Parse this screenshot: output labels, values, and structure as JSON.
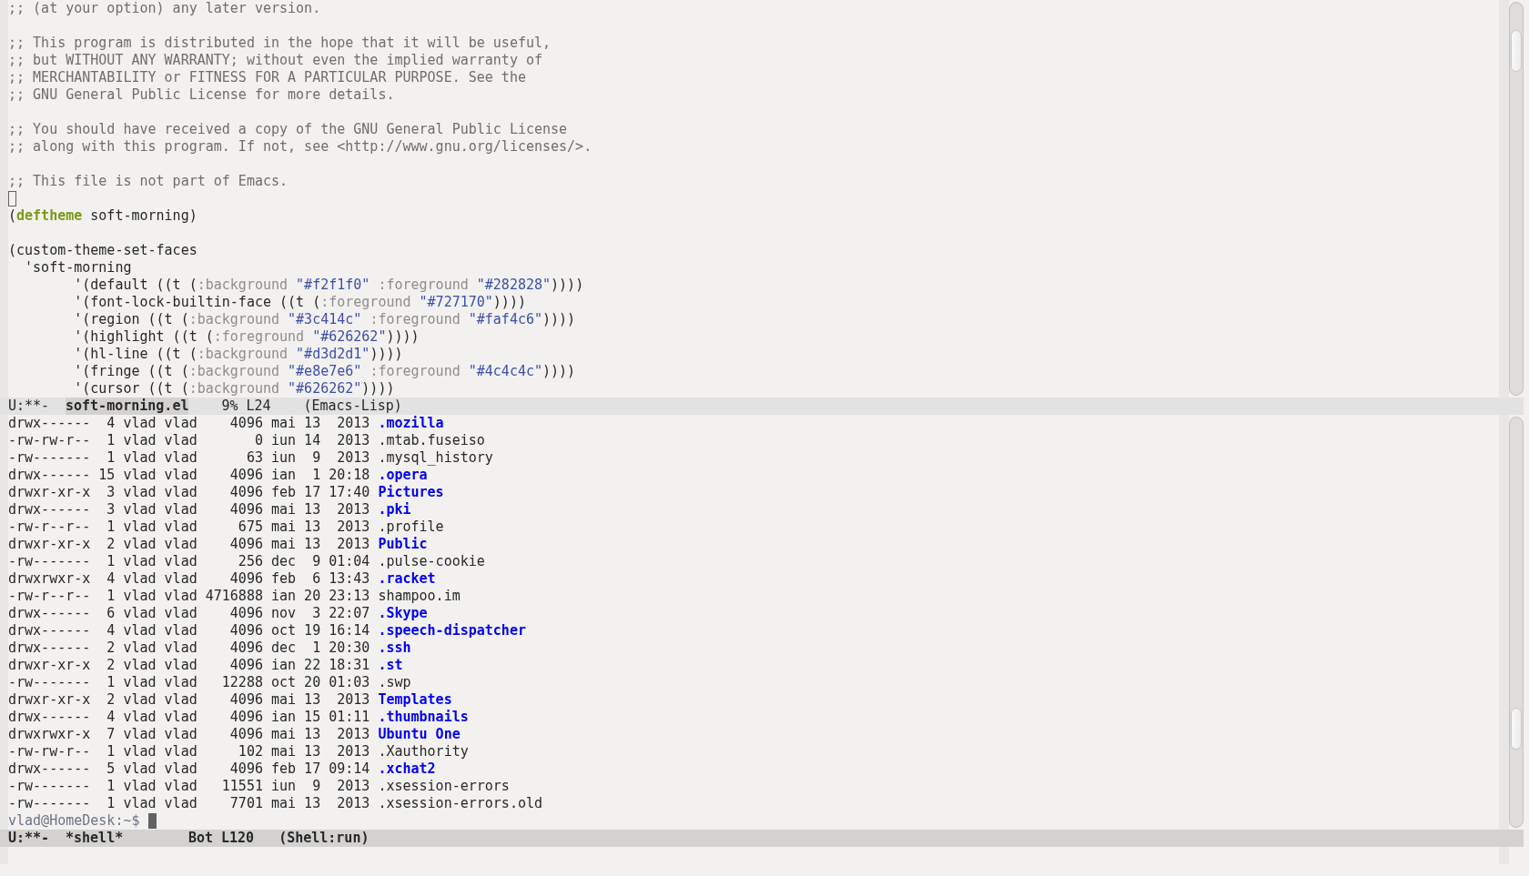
{
  "editor_pane": {
    "paragraphs": [
      {
        "lines": [
          {
            "segments": [
              {
                "kind": "comment",
                "text": ";; (at your option) any later version."
              }
            ]
          }
        ]
      },
      {
        "lines": [
          {
            "segments": [
              {
                "kind": "comment",
                "text": ";; This program is distributed in the hope that it will be useful,"
              }
            ]
          },
          {
            "segments": [
              {
                "kind": "comment",
                "text": ";; but WITHOUT ANY WARRANTY; without even the implied warranty of"
              }
            ]
          },
          {
            "segments": [
              {
                "kind": "comment",
                "text": ";; MERCHANTABILITY or FITNESS FOR A PARTICULAR PURPOSE. See the"
              }
            ]
          },
          {
            "segments": [
              {
                "kind": "comment",
                "text": ";; GNU General Public License for more details."
              }
            ]
          }
        ]
      },
      {
        "lines": [
          {
            "segments": [
              {
                "kind": "comment",
                "text": ";; You should have received a copy of the GNU General Public License"
              }
            ]
          },
          {
            "segments": [
              {
                "kind": "comment",
                "text": ";; along with this program. If not, see <http://www.gnu.org/licenses/>."
              }
            ]
          }
        ]
      },
      {
        "lines": [
          {
            "segments": [
              {
                "kind": "comment",
                "text": ";; This file is not part of Emacs."
              }
            ]
          },
          {
            "cursor": true
          },
          {
            "segments": [
              {
                "kind": "text",
                "text": "("
              },
              {
                "kind": "keyword",
                "text": "deftheme"
              },
              {
                "kind": "text",
                "text": " soft-morning)"
              }
            ]
          }
        ]
      },
      {
        "lines": [
          {
            "segments": [
              {
                "kind": "text",
                "text": "(custom-theme-set-faces"
              }
            ]
          },
          {
            "segments": [
              {
                "kind": "text",
                "text": "  'soft-morning"
              }
            ]
          },
          {
            "segments": [
              {
                "kind": "text",
                "text": "        '(default ((t ("
              },
              {
                "kind": "builtin",
                "text": ":background "
              },
              {
                "kind": "string",
                "text": "\"#f2f1f0\" "
              },
              {
                "kind": "builtin",
                "text": ":foreground "
              },
              {
                "kind": "string",
                "text": "\"#282828\""
              },
              {
                "kind": "text",
                "text": "))))"
              }
            ]
          },
          {
            "segments": [
              {
                "kind": "text",
                "text": "        '(font-lock-builtin-face ((t ("
              },
              {
                "kind": "builtin",
                "text": ":foreground "
              },
              {
                "kind": "string",
                "text": "\"#727170\""
              },
              {
                "kind": "text",
                "text": "))))"
              }
            ]
          },
          {
            "segments": [
              {
                "kind": "text",
                "text": "        '(region ((t ("
              },
              {
                "kind": "builtin",
                "text": ":background "
              },
              {
                "kind": "string",
                "text": "\"#3c414c\" "
              },
              {
                "kind": "builtin",
                "text": ":foreground "
              },
              {
                "kind": "string",
                "text": "\"#faf4c6\""
              },
              {
                "kind": "text",
                "text": "))))"
              }
            ]
          },
          {
            "segments": [
              {
                "kind": "text",
                "text": "        '(highlight ((t ("
              },
              {
                "kind": "builtin",
                "text": ":foreground "
              },
              {
                "kind": "string",
                "text": "\"#626262\""
              },
              {
                "kind": "text",
                "text": "))))"
              }
            ]
          },
          {
            "segments": [
              {
                "kind": "text",
                "text": "        '(hl-line ((t ("
              },
              {
                "kind": "builtin",
                "text": ":background "
              },
              {
                "kind": "string",
                "text": "\"#d3d2d1\""
              },
              {
                "kind": "text",
                "text": "))))"
              }
            ]
          },
          {
            "segments": [
              {
                "kind": "text",
                "text": "        '(fringe ((t ("
              },
              {
                "kind": "builtin",
                "text": ":background "
              },
              {
                "kind": "string",
                "text": "\"#e8e7e6\" "
              },
              {
                "kind": "builtin",
                "text": ":foreground "
              },
              {
                "kind": "string",
                "text": "\"#4c4c4c\""
              },
              {
                "kind": "text",
                "text": "))))"
              }
            ]
          },
          {
            "segments": [
              {
                "kind": "text",
                "text": "        '(cursor ((t ("
              },
              {
                "kind": "builtin",
                "text": ":background "
              },
              {
                "kind": "string",
                "text": "\"#626262\""
              },
              {
                "kind": "text",
                "text": "))))"
              }
            ]
          }
        ]
      }
    ],
    "mode_line": {
      "status": "U:**-",
      "buffer": "soft-morning.el",
      "percent": "9%",
      "line": "L24",
      "mode": "(Emacs-Lisp)",
      "active": false
    }
  },
  "shell_pane": {
    "entries": [
      {
        "perms": "drwx------",
        "links": "4",
        "owner": "vlad",
        "group": "vlad",
        "size": "4096",
        "month": "mai",
        "day": "13",
        "time": "2013",
        "name": ".mozilla",
        "kind": "directory"
      },
      {
        "perms": "-rw-rw-r--",
        "links": "1",
        "owner": "vlad",
        "group": "vlad",
        "size": "0",
        "month": "iun",
        "day": "14",
        "time": "2013",
        "name": ".mtab.fuseiso",
        "kind": "file"
      },
      {
        "perms": "-rw-------",
        "links": "1",
        "owner": "vlad",
        "group": "vlad",
        "size": "63",
        "month": "iun",
        "day": "9",
        "time": "2013",
        "name": ".mysql_history",
        "kind": "file"
      },
      {
        "perms": "drwx------",
        "links": "15",
        "owner": "vlad",
        "group": "vlad",
        "size": "4096",
        "month": "ian",
        "day": "1",
        "time": "20:18",
        "name": ".opera",
        "kind": "directory"
      },
      {
        "perms": "drwxr-xr-x",
        "links": "3",
        "owner": "vlad",
        "group": "vlad",
        "size": "4096",
        "month": "feb",
        "day": "17",
        "time": "17:40",
        "name": "Pictures",
        "kind": "directory"
      },
      {
        "perms": "drwx------",
        "links": "3",
        "owner": "vlad",
        "group": "vlad",
        "size": "4096",
        "month": "mai",
        "day": "13",
        "time": "2013",
        "name": ".pki",
        "kind": "directory"
      },
      {
        "perms": "-rw-r--r--",
        "links": "1",
        "owner": "vlad",
        "group": "vlad",
        "size": "675",
        "month": "mai",
        "day": "13",
        "time": "2013",
        "name": ".profile",
        "kind": "file"
      },
      {
        "perms": "drwxr-xr-x",
        "links": "2",
        "owner": "vlad",
        "group": "vlad",
        "size": "4096",
        "month": "mai",
        "day": "13",
        "time": "2013",
        "name": "Public",
        "kind": "directory"
      },
      {
        "perms": "-rw-------",
        "links": "1",
        "owner": "vlad",
        "group": "vlad",
        "size": "256",
        "month": "dec",
        "day": "9",
        "time": "01:04",
        "name": ".pulse-cookie",
        "kind": "file"
      },
      {
        "perms": "drwxrwxr-x",
        "links": "4",
        "owner": "vlad",
        "group": "vlad",
        "size": "4096",
        "month": "feb",
        "day": "6",
        "time": "13:43",
        "name": ".racket",
        "kind": "directory"
      },
      {
        "perms": "-rw-r--r--",
        "links": "1",
        "owner": "vlad",
        "group": "vlad",
        "size": "4716888",
        "month": "ian",
        "day": "20",
        "time": "23:13",
        "name": "shampoo.im",
        "kind": "file"
      },
      {
        "perms": "drwx------",
        "links": "6",
        "owner": "vlad",
        "group": "vlad",
        "size": "4096",
        "month": "nov",
        "day": "3",
        "time": "22:07",
        "name": ".Skype",
        "kind": "directory"
      },
      {
        "perms": "drwx------",
        "links": "4",
        "owner": "vlad",
        "group": "vlad",
        "size": "4096",
        "month": "oct",
        "day": "19",
        "time": "16:14",
        "name": ".speech-dispatcher",
        "kind": "directory"
      },
      {
        "perms": "drwx------",
        "links": "2",
        "owner": "vlad",
        "group": "vlad",
        "size": "4096",
        "month": "dec",
        "day": "1",
        "time": "20:30",
        "name": ".ssh",
        "kind": "directory"
      },
      {
        "perms": "drwxr-xr-x",
        "links": "2",
        "owner": "vlad",
        "group": "vlad",
        "size": "4096",
        "month": "ian",
        "day": "22",
        "time": "18:31",
        "name": ".st",
        "kind": "directory"
      },
      {
        "perms": "-rw-------",
        "links": "1",
        "owner": "vlad",
        "group": "vlad",
        "size": "12288",
        "month": "oct",
        "day": "20",
        "time": "01:03",
        "name": ".swp",
        "kind": "file"
      },
      {
        "perms": "drwxr-xr-x",
        "links": "2",
        "owner": "vlad",
        "group": "vlad",
        "size": "4096",
        "month": "mai",
        "day": "13",
        "time": "2013",
        "name": "Templates",
        "kind": "directory"
      },
      {
        "perms": "drwx------",
        "links": "4",
        "owner": "vlad",
        "group": "vlad",
        "size": "4096",
        "month": "ian",
        "day": "15",
        "time": "01:11",
        "name": ".thumbnails",
        "kind": "directory"
      },
      {
        "perms": "drwxrwxr-x",
        "links": "7",
        "owner": "vlad",
        "group": "vlad",
        "size": "4096",
        "month": "mai",
        "day": "13",
        "time": "2013",
        "name": "Ubuntu One",
        "kind": "directory"
      },
      {
        "perms": "-rw-rw-r--",
        "links": "1",
        "owner": "vlad",
        "group": "vlad",
        "size": "102",
        "month": "mai",
        "day": "13",
        "time": "2013",
        "name": ".Xauthority",
        "kind": "file"
      },
      {
        "perms": "drwx------",
        "links": "5",
        "owner": "vlad",
        "group": "vlad",
        "size": "4096",
        "month": "feb",
        "day": "17",
        "time": "09:14",
        "name": ".xchat2",
        "kind": "directory"
      },
      {
        "perms": "-rw-------",
        "links": "1",
        "owner": "vlad",
        "group": "vlad",
        "size": "11551",
        "month": "iun",
        "day": "9",
        "time": "2013",
        "name": ".xsession-errors",
        "kind": "file"
      },
      {
        "perms": "-rw-------",
        "links": "1",
        "owner": "vlad",
        "group": "vlad",
        "size": "7701",
        "month": "mai",
        "day": "13",
        "time": "2013",
        "name": ".xsession-errors.old",
        "kind": "file"
      }
    ],
    "prompt": "vlad@HomeDesk:~$",
    "cursor": true,
    "mode_line": {
      "status": "U:**-",
      "buffer": "*shell*",
      "percent": "Bot",
      "line": "L120",
      "mode": "(Shell:run)",
      "active": true
    }
  }
}
